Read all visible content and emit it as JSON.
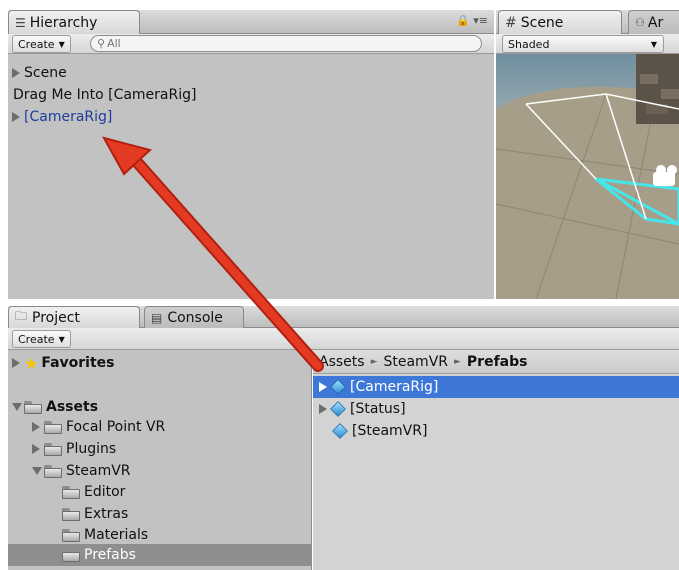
{
  "hierarchy": {
    "tab_label": "Hierarchy",
    "create_label": "Create",
    "search_placeholder": "All",
    "items": [
      {
        "label": "Scene"
      },
      {
        "label": "Drag Me Into [CameraRig]"
      },
      {
        "label": "[CameraRig]"
      }
    ]
  },
  "scene": {
    "tab_label": "Scene",
    "tab2_label": "Ar",
    "shading_mode": "Shaded"
  },
  "project": {
    "tab_label": "Project",
    "console_tab_label": "Console",
    "create_label": "Create",
    "favorites_label": "Favorites",
    "assets_label": "Assets",
    "tree": [
      {
        "label": "Focal Point VR"
      },
      {
        "label": "Plugins"
      },
      {
        "label": "SteamVR"
      },
      {
        "label": "Editor"
      },
      {
        "label": "Extras"
      },
      {
        "label": "Materials"
      },
      {
        "label": "Prefabs"
      }
    ],
    "breadcrumb": {
      "part1": "Assets",
      "part2": "SteamVR",
      "part3": "Prefabs",
      "sep": "►"
    },
    "assets": [
      {
        "label": "[CameraRig]"
      },
      {
        "label": "[Status]"
      },
      {
        "label": "[SteamVR]"
      }
    ]
  },
  "colors": {
    "selection": "#3d78d8",
    "arrow": "#e53a22",
    "highlight_text": "#1c3d9c"
  }
}
